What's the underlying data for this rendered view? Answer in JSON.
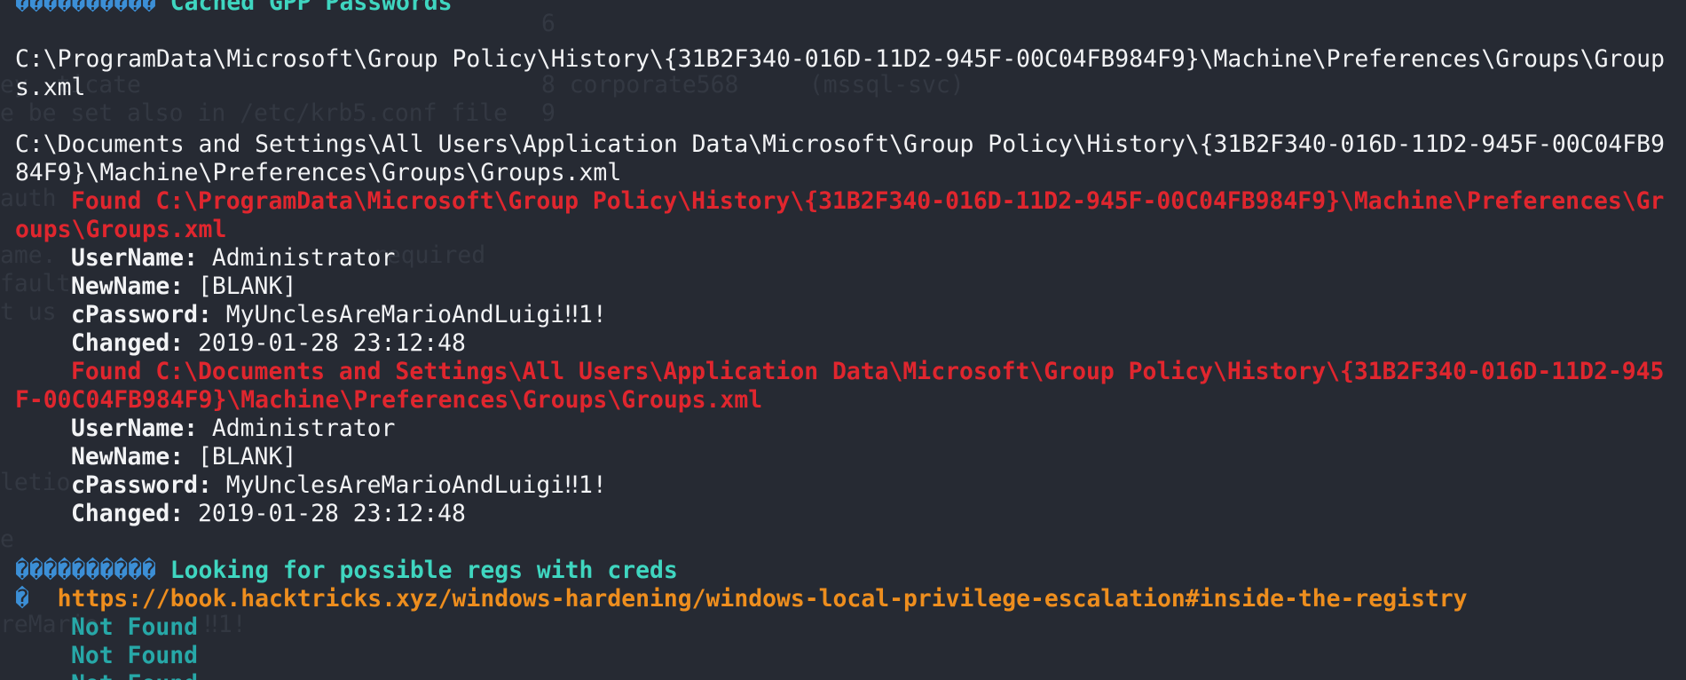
{
  "ghost_fragments": [
    "6",
    "ey  ticate",
    "8 corporate568     (mssql-svc)",
    "9",
    "e be set also in /etc/krb5.conf file",
    "auth",
    "ame.",
    "required",
    "fault",
    "t us",
    "letio",
    "e",
    "reMario",
    "‼1!"
  ],
  "sections": {
    "cached_gpp": {
      "glyphs": "����������",
      "title": "Cached GPP Passwords",
      "paths": [
        "C:\\ProgramData\\Microsoft\\Group Policy\\History\\{31B2F340-016D-11D2-945F-00C04FB984F9}\\Machine\\Preferences\\Groups\\Groups.xml",
        "C:\\Documents and Settings\\All Users\\Application Data\\Microsoft\\Group Policy\\History\\{31B2F340-016D-11D2-945F-00C04FB984F9}\\Machine\\Preferences\\Groups\\Groups.xml"
      ],
      "findings": [
        {
          "found": "Found C:\\ProgramData\\Microsoft\\Group Policy\\History\\{31B2F340-016D-11D2-945F-00C04FB984F9}\\Machine\\Preferences\\Groups\\Groups.xml",
          "fields": [
            {
              "key": "UserName:",
              "value": "Administrator"
            },
            {
              "key": "NewName:",
              "value": "[BLANK]"
            },
            {
              "key": "cPassword:",
              "value": "MyUnclesAreMarioAndLuigi‼1!"
            },
            {
              "key": "Changed:",
              "value": "2019-01-28 23:12:48"
            }
          ]
        },
        {
          "found": "Found C:\\Documents and Settings\\All Users\\Application Data\\Microsoft\\Group Policy\\History\\{31B2F340-016D-11D2-945F-00C04FB984F9}\\Machine\\Preferences\\Groups\\Groups.xml",
          "fields": [
            {
              "key": "UserName:",
              "value": "Administrator"
            },
            {
              "key": "NewName:",
              "value": "[BLANK]"
            },
            {
              "key": "cPassword:",
              "value": "MyUnclesAreMarioAndLuigi‼1!"
            },
            {
              "key": "Changed:",
              "value": "2019-01-28 23:12:48"
            }
          ]
        }
      ]
    },
    "regs": {
      "glyphs": "����������",
      "title": "Looking for possible regs with creds",
      "link_glyph": "�",
      "link": "https://book.hacktricks.xyz/windows-hardening/windows-local-privilege-escalation#inside-the-registry",
      "results": [
        "Not Found",
        "Not Found",
        "Not Found"
      ]
    }
  },
  "colors": {
    "background": "#262a33",
    "text": "#f2f3f5",
    "found": "#e0262e",
    "header": "#3fd6c0",
    "link": "#ee8e1e",
    "not_found": "#27a8a8"
  }
}
